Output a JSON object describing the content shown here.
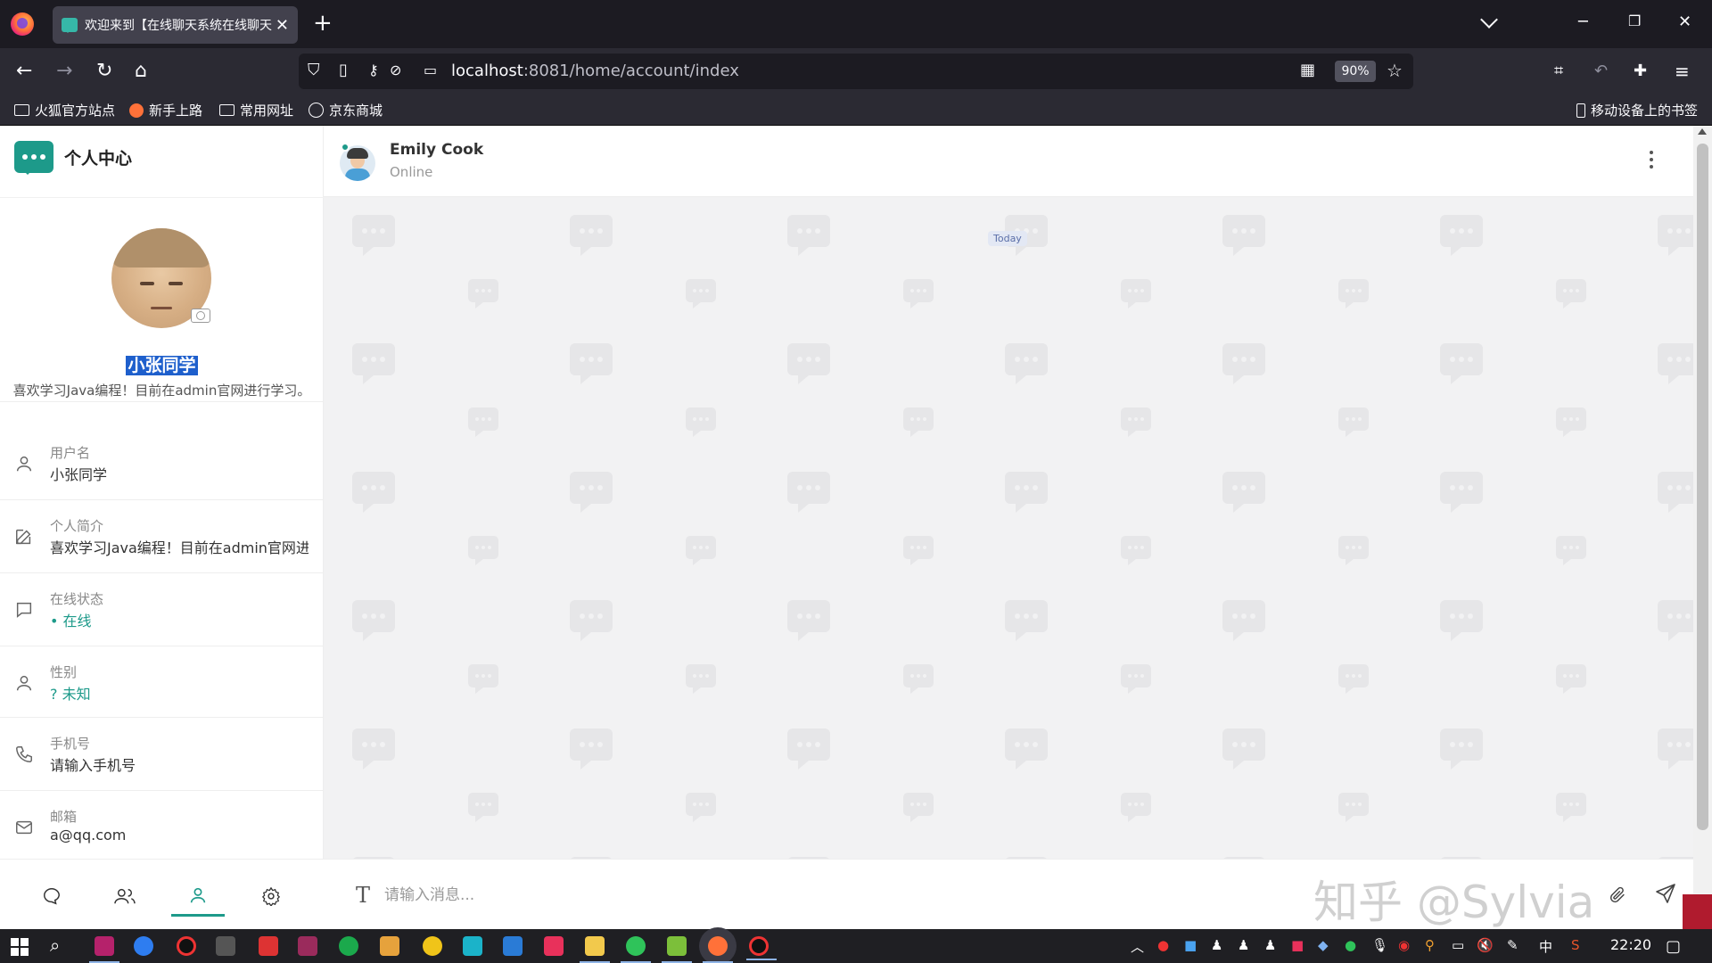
{
  "browser": {
    "tab_title": "欢迎来到【在线聊天系统在线聊天】",
    "url_host": "localhost",
    "url_rest": ":8081/home/account/index",
    "zoom": "90%",
    "bookmarks": [
      "火狐官方站点",
      "新手上路",
      "常用网址",
      "京东商城"
    ],
    "mobile_bookmarks": "移动设备上的书签"
  },
  "sidebar": {
    "title": "个人中心",
    "profile": {
      "name": "小张同学",
      "bio": "喜欢学习Java编程！目前在admin官网进行学习。"
    },
    "fields": [
      {
        "label": "用户名",
        "value": "小张同学"
      },
      {
        "label": "个人简介",
        "value": "喜欢学习Java编程！目前在admin官网进行学习。"
      },
      {
        "label": "在线状态",
        "value": "• 在线"
      },
      {
        "label": "性别",
        "value": "? 未知"
      },
      {
        "label": "手机号",
        "value": "请输入手机号"
      },
      {
        "label": "邮箱",
        "value": "a@qq.com"
      }
    ]
  },
  "chat": {
    "contact_name": "Emily Cook",
    "contact_status": "Online",
    "date_divider": "Today",
    "input_placeholder": "请输入消息...",
    "watermark": "知乎 @Sylvia"
  },
  "taskbar": {
    "time": "22:20",
    "ime": "中"
  },
  "colors": {
    "accent": "#1d9a8a",
    "selection": "#1e5fcc",
    "chrome_bg": "#1c1b22",
    "toolbar_bg": "#2b2a33",
    "chat_bg": "#f2f2f3"
  }
}
